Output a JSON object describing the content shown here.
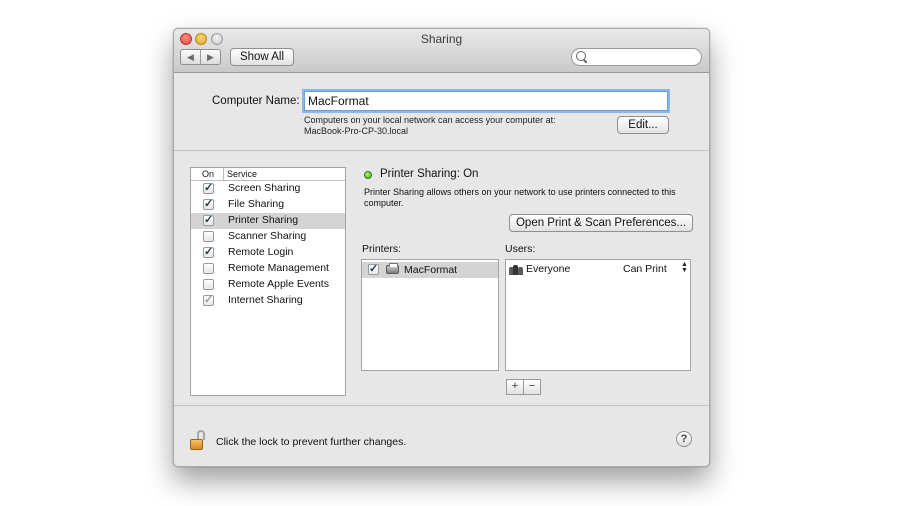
{
  "window": {
    "title": "Sharing"
  },
  "toolbar": {
    "back_glyph": "◀",
    "forward_glyph": "▶",
    "show_all_label": "Show All",
    "search_placeholder": ""
  },
  "computer_name": {
    "label": "Computer Name:",
    "value": "MacFormat",
    "info_line1": "Computers on your local network can access your computer at:",
    "info_line2": "MacBook-Pro-CP-30.local",
    "edit_label": "Edit..."
  },
  "service_list": {
    "header_on": "On",
    "header_service": "Service",
    "items": [
      {
        "label": "Screen Sharing",
        "checked": true,
        "mark": "✓"
      },
      {
        "label": "File Sharing",
        "checked": true,
        "mark": "✓"
      },
      {
        "label": "Printer Sharing",
        "checked": true,
        "mark": "✓",
        "selected": true
      },
      {
        "label": "Scanner Sharing",
        "checked": false,
        "mark": ""
      },
      {
        "label": "Remote Login",
        "checked": true,
        "mark": "✓"
      },
      {
        "label": "Remote Management",
        "checked": false,
        "mark": ""
      },
      {
        "label": "Remote Apple Events",
        "checked": false,
        "mark": ""
      },
      {
        "label": "Internet Sharing",
        "checked": true,
        "mark": "✓",
        "disabled": true
      }
    ]
  },
  "detail": {
    "status": "Printer Sharing: On",
    "status_color": "#39a31a",
    "description": "Printer Sharing allows others on your network to use printers connected to this computer.",
    "open_prefs_label": "Open Print & Scan Preferences...",
    "printers_label": "Printers:",
    "users_label": "Users:",
    "printers": [
      {
        "name": "MacFormat",
        "checked": true,
        "mark": "✓"
      }
    ],
    "users": [
      {
        "name": "Everyone",
        "permission": "Can Print",
        "stepper": "▲▼"
      }
    ],
    "add_label": "+",
    "remove_label": "−"
  },
  "footer": {
    "lock_text": "Click the lock to prevent further changes.",
    "help_label": "?"
  },
  "icons": {
    "search": "search-icon",
    "lock": "lock-open-icon",
    "printer": "printer-icon",
    "group": "group-icon",
    "help": "help-icon"
  }
}
